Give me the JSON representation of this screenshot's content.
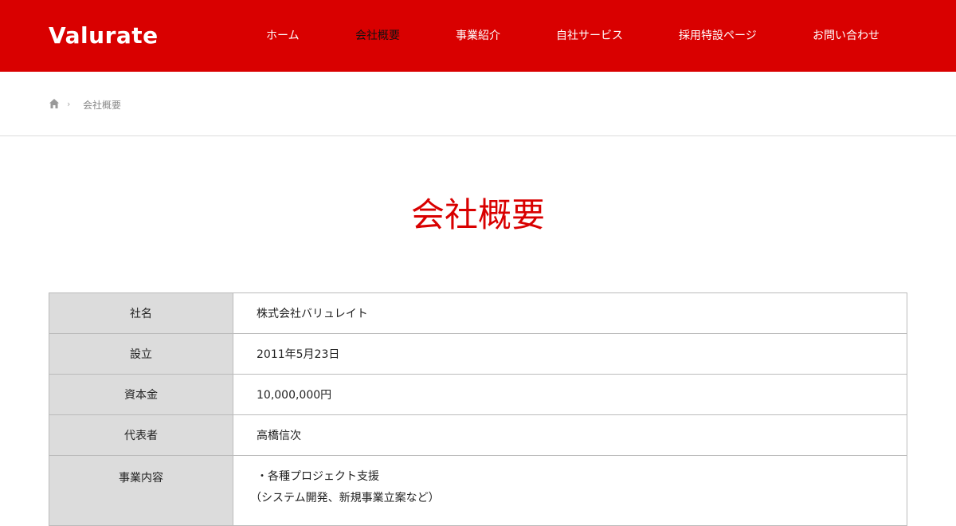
{
  "header": {
    "logo_text": "Valurate",
    "nav": [
      {
        "label": "ホーム",
        "active": false
      },
      {
        "label": "会社概要",
        "active": true
      },
      {
        "label": "事業紹介",
        "active": false
      },
      {
        "label": "自社サービス",
        "active": false
      },
      {
        "label": "採用特設ページ",
        "active": false
      },
      {
        "label": "お問い合わせ",
        "active": false
      }
    ]
  },
  "breadcrumb": {
    "home_icon": "home-icon",
    "separator": "›",
    "current": "会社概要"
  },
  "page": {
    "title": "会社概要"
  },
  "company_table": {
    "rows": [
      {
        "label": "社名",
        "value": "株式会社バリュレイト"
      },
      {
        "label": "設立",
        "value": "2011年5月23日"
      },
      {
        "label": "資本金",
        "value": "10,000,000円"
      },
      {
        "label": "代表者",
        "value": "高橋信次"
      },
      {
        "label": "事業内容",
        "value": "・各種プロジェクト支援",
        "value_line2": "（システム開発、新規事業立案など）"
      }
    ]
  },
  "colors": {
    "brand_red": "#d90000",
    "table_header_bg": "#dcdcdc",
    "border": "#bbbbbb"
  }
}
